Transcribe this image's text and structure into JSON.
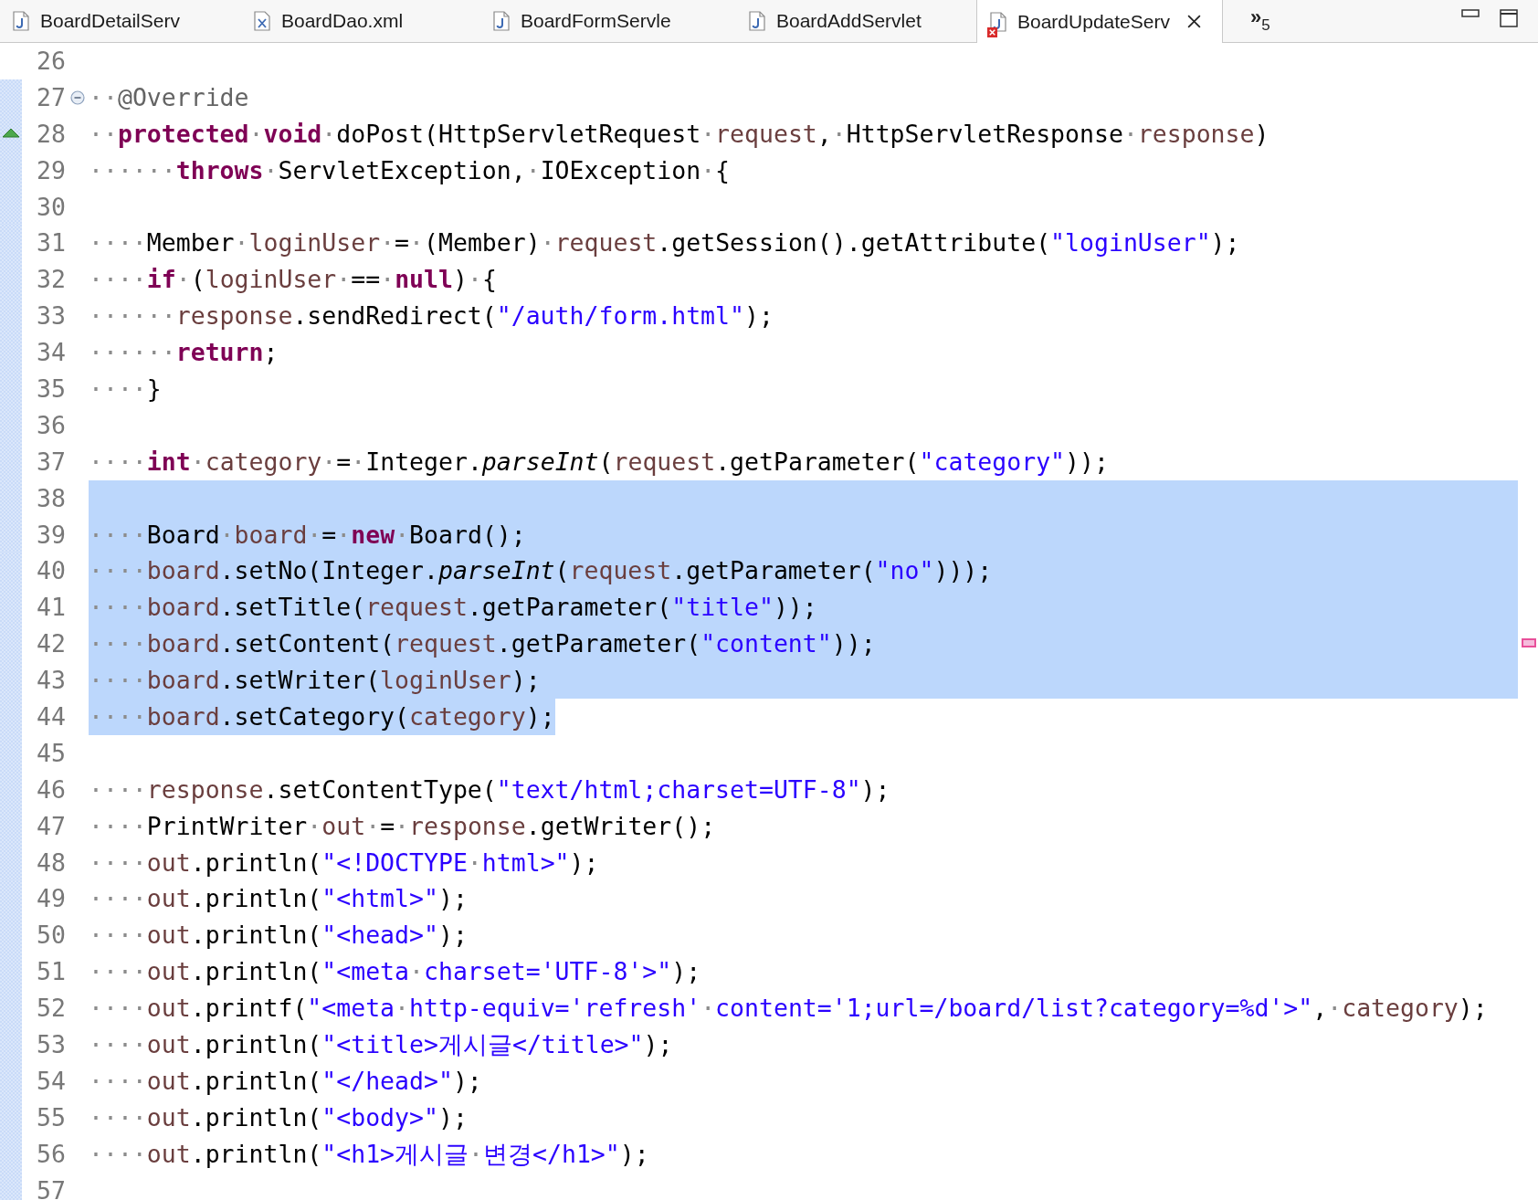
{
  "tabs": [
    {
      "label": "BoardDetailServ",
      "kind": "java",
      "selected": false,
      "error": false
    },
    {
      "label": "BoardDao.xml",
      "kind": "xml",
      "selected": false,
      "error": false
    },
    {
      "label": "BoardFormServle",
      "kind": "java",
      "selected": false,
      "error": false
    },
    {
      "label": "BoardAddServlet",
      "kind": "java",
      "selected": false,
      "error": false
    },
    {
      "label": "BoardUpdateServ",
      "kind": "java",
      "selected": true,
      "error": true
    }
  ],
  "overflow": {
    "chevron": "»",
    "count": "5"
  },
  "lines": [
    {
      "number": "26",
      "changed": false,
      "selected": false
    },
    {
      "number": "27",
      "changed": true,
      "selected": false,
      "foldable": true,
      "tokens": [
        {
          "kind": "ws",
          "text": "··"
        },
        {
          "kind": "ann",
          "text": "@Override"
        }
      ]
    },
    {
      "number": "28",
      "changed": true,
      "selected": false,
      "override": true,
      "tokens": [
        {
          "kind": "ws",
          "text": "··"
        },
        {
          "kind": "kw",
          "text": "protected"
        },
        {
          "kind": "ws",
          "text": "·"
        },
        {
          "kind": "kw",
          "text": "void"
        },
        {
          "kind": "ws",
          "text": "·"
        },
        {
          "kind": "p",
          "text": "doPost(HttpServletRequest"
        },
        {
          "kind": "ws",
          "text": "·"
        },
        {
          "kind": "var",
          "text": "request"
        },
        {
          "kind": "p",
          "text": ","
        },
        {
          "kind": "ws",
          "text": "·"
        },
        {
          "kind": "p",
          "text": "HttpServletResponse"
        },
        {
          "kind": "ws",
          "text": "·"
        },
        {
          "kind": "var",
          "text": "response"
        },
        {
          "kind": "p",
          "text": ")"
        }
      ]
    },
    {
      "number": "29",
      "changed": true,
      "selected": false,
      "tokens": [
        {
          "kind": "ws",
          "text": "······"
        },
        {
          "kind": "kw",
          "text": "throws"
        },
        {
          "kind": "ws",
          "text": "·"
        },
        {
          "kind": "p",
          "text": "ServletException,"
        },
        {
          "kind": "ws",
          "text": "·"
        },
        {
          "kind": "p",
          "text": "IOException"
        },
        {
          "kind": "ws",
          "text": "·"
        },
        {
          "kind": "p",
          "text": "{"
        }
      ]
    },
    {
      "number": "30",
      "changed": true,
      "selected": false
    },
    {
      "number": "31",
      "changed": true,
      "selected": false,
      "tokens": [
        {
          "kind": "ws",
          "text": "····"
        },
        {
          "kind": "p",
          "text": "Member"
        },
        {
          "kind": "ws",
          "text": "·"
        },
        {
          "kind": "var",
          "text": "loginUser"
        },
        {
          "kind": "ws",
          "text": "·"
        },
        {
          "kind": "p",
          "text": "="
        },
        {
          "kind": "ws",
          "text": "·"
        },
        {
          "kind": "p",
          "text": "(Member)"
        },
        {
          "kind": "ws",
          "text": "·"
        },
        {
          "kind": "var",
          "text": "request"
        },
        {
          "kind": "p",
          "text": ".getSession().getAttribute("
        },
        {
          "kind": "str",
          "text": "\"loginUser\""
        },
        {
          "kind": "p",
          "text": ");"
        }
      ]
    },
    {
      "number": "32",
      "changed": true,
      "selected": false,
      "tokens": [
        {
          "kind": "ws",
          "text": "····"
        },
        {
          "kind": "kw",
          "text": "if"
        },
        {
          "kind": "ws",
          "text": "·"
        },
        {
          "kind": "p",
          "text": "("
        },
        {
          "kind": "var",
          "text": "loginUser"
        },
        {
          "kind": "ws",
          "text": "·"
        },
        {
          "kind": "p",
          "text": "=="
        },
        {
          "kind": "ws",
          "text": "·"
        },
        {
          "kind": "kw",
          "text": "null"
        },
        {
          "kind": "p",
          "text": ")"
        },
        {
          "kind": "ws",
          "text": "·"
        },
        {
          "kind": "p",
          "text": "{"
        }
      ]
    },
    {
      "number": "33",
      "changed": true,
      "selected": false,
      "tokens": [
        {
          "kind": "ws",
          "text": "······"
        },
        {
          "kind": "var",
          "text": "response"
        },
        {
          "kind": "p",
          "text": ".sendRedirect("
        },
        {
          "kind": "str",
          "text": "\"/auth/form.html\""
        },
        {
          "kind": "p",
          "text": ");"
        }
      ]
    },
    {
      "number": "34",
      "changed": true,
      "selected": false,
      "tokens": [
        {
          "kind": "ws",
          "text": "······"
        },
        {
          "kind": "kw",
          "text": "return"
        },
        {
          "kind": "p",
          "text": ";"
        }
      ]
    },
    {
      "number": "35",
      "changed": true,
      "selected": false,
      "tokens": [
        {
          "kind": "ws",
          "text": "····"
        },
        {
          "kind": "p",
          "text": "}"
        }
      ]
    },
    {
      "number": "36",
      "changed": true,
      "selected": false
    },
    {
      "number": "37",
      "changed": true,
      "selected": false,
      "tokens": [
        {
          "kind": "ws",
          "text": "····"
        },
        {
          "kind": "kw",
          "text": "int"
        },
        {
          "kind": "ws",
          "text": "·"
        },
        {
          "kind": "var",
          "text": "category"
        },
        {
          "kind": "ws",
          "text": "·"
        },
        {
          "kind": "p",
          "text": "="
        },
        {
          "kind": "ws",
          "text": "·"
        },
        {
          "kind": "p",
          "text": "Integer."
        },
        {
          "kind": "it",
          "text": "parseInt"
        },
        {
          "kind": "p",
          "text": "("
        },
        {
          "kind": "var",
          "text": "request"
        },
        {
          "kind": "p",
          "text": ".getParameter("
        },
        {
          "kind": "str",
          "text": "\"category\""
        },
        {
          "kind": "p",
          "text": "));"
        }
      ]
    },
    {
      "number": "38",
      "changed": true,
      "selected": true
    },
    {
      "number": "39",
      "changed": true,
      "selected": true,
      "tokens": [
        {
          "kind": "ws",
          "text": "····"
        },
        {
          "kind": "p",
          "text": "Board"
        },
        {
          "kind": "ws",
          "text": "·"
        },
        {
          "kind": "var",
          "text": "board"
        },
        {
          "kind": "ws",
          "text": "·"
        },
        {
          "kind": "p",
          "text": "="
        },
        {
          "kind": "ws",
          "text": "·"
        },
        {
          "kind": "kw",
          "text": "new"
        },
        {
          "kind": "ws",
          "text": "·"
        },
        {
          "kind": "p",
          "text": "Board();"
        }
      ]
    },
    {
      "number": "40",
      "changed": true,
      "selected": true,
      "tokens": [
        {
          "kind": "ws",
          "text": "····"
        },
        {
          "kind": "var",
          "text": "board"
        },
        {
          "kind": "p",
          "text": ".setNo(Integer."
        },
        {
          "kind": "it",
          "text": "parseInt"
        },
        {
          "kind": "p",
          "text": "("
        },
        {
          "kind": "var",
          "text": "request"
        },
        {
          "kind": "p",
          "text": ".getParameter("
        },
        {
          "kind": "str",
          "text": "\"no\""
        },
        {
          "kind": "p",
          "text": ")));"
        }
      ]
    },
    {
      "number": "41",
      "changed": true,
      "selected": true,
      "tokens": [
        {
          "kind": "ws",
          "text": "····"
        },
        {
          "kind": "var",
          "text": "board"
        },
        {
          "kind": "p",
          "text": ".setTitle("
        },
        {
          "kind": "var",
          "text": "request"
        },
        {
          "kind": "p",
          "text": ".getParameter("
        },
        {
          "kind": "str",
          "text": "\"title\""
        },
        {
          "kind": "p",
          "text": "));"
        }
      ]
    },
    {
      "number": "42",
      "changed": true,
      "selected": true,
      "ruler_mark": true,
      "tokens": [
        {
          "kind": "ws",
          "text": "····"
        },
        {
          "kind": "var",
          "text": "board"
        },
        {
          "kind": "p",
          "text": ".setContent("
        },
        {
          "kind": "var",
          "text": "request"
        },
        {
          "kind": "p",
          "text": ".getParameter("
        },
        {
          "kind": "str",
          "text": "\"content\""
        },
        {
          "kind": "p",
          "text": "));"
        }
      ]
    },
    {
      "number": "43",
      "changed": true,
      "selected": true,
      "tokens": [
        {
          "kind": "ws",
          "text": "····"
        },
        {
          "kind": "var",
          "text": "board"
        },
        {
          "kind": "p",
          "text": ".setWriter("
        },
        {
          "kind": "var",
          "text": "loginUser"
        },
        {
          "kind": "p",
          "text": ");"
        }
      ]
    },
    {
      "number": "44",
      "changed": true,
      "selected": true,
      "partial": true,
      "tokens": [
        {
          "kind": "ws",
          "text": "····"
        },
        {
          "kind": "var",
          "text": "board"
        },
        {
          "kind": "p",
          "text": ".setCategory("
        },
        {
          "kind": "var",
          "text": "category"
        },
        {
          "kind": "p",
          "text": ");"
        }
      ]
    },
    {
      "number": "45",
      "changed": true,
      "selected": false
    },
    {
      "number": "46",
      "changed": true,
      "selected": false,
      "tokens": [
        {
          "kind": "ws",
          "text": "····"
        },
        {
          "kind": "var",
          "text": "response"
        },
        {
          "kind": "p",
          "text": ".setContentType("
        },
        {
          "kind": "str",
          "text": "\"text/html;charset=UTF-8\""
        },
        {
          "kind": "p",
          "text": ");"
        }
      ]
    },
    {
      "number": "47",
      "changed": true,
      "selected": false,
      "tokens": [
        {
          "kind": "ws",
          "text": "····"
        },
        {
          "kind": "p",
          "text": "PrintWriter"
        },
        {
          "kind": "ws",
          "text": "·"
        },
        {
          "kind": "var",
          "text": "out"
        },
        {
          "kind": "ws",
          "text": "·"
        },
        {
          "kind": "p",
          "text": "="
        },
        {
          "kind": "ws",
          "text": "·"
        },
        {
          "kind": "var",
          "text": "response"
        },
        {
          "kind": "p",
          "text": ".getWriter();"
        }
      ]
    },
    {
      "number": "48",
      "changed": true,
      "selected": false,
      "tokens": [
        {
          "kind": "ws",
          "text": "····"
        },
        {
          "kind": "var",
          "text": "out"
        },
        {
          "kind": "p",
          "text": ".println("
        },
        {
          "kind": "str",
          "text": "\"<!DOCTYPE"
        },
        {
          "kind": "ws",
          "text": "·"
        },
        {
          "kind": "str",
          "text": "html>\""
        },
        {
          "kind": "p",
          "text": ");"
        }
      ]
    },
    {
      "number": "49",
      "changed": true,
      "selected": false,
      "tokens": [
        {
          "kind": "ws",
          "text": "····"
        },
        {
          "kind": "var",
          "text": "out"
        },
        {
          "kind": "p",
          "text": ".println("
        },
        {
          "kind": "str",
          "text": "\"<html>\""
        },
        {
          "kind": "p",
          "text": ");"
        }
      ]
    },
    {
      "number": "50",
      "changed": true,
      "selected": false,
      "tokens": [
        {
          "kind": "ws",
          "text": "····"
        },
        {
          "kind": "var",
          "text": "out"
        },
        {
          "kind": "p",
          "text": ".println("
        },
        {
          "kind": "str",
          "text": "\"<head>\""
        },
        {
          "kind": "p",
          "text": ");"
        }
      ]
    },
    {
      "number": "51",
      "changed": true,
      "selected": false,
      "tokens": [
        {
          "kind": "ws",
          "text": "····"
        },
        {
          "kind": "var",
          "text": "out"
        },
        {
          "kind": "p",
          "text": ".println("
        },
        {
          "kind": "str",
          "text": "\"<meta"
        },
        {
          "kind": "ws",
          "text": "·"
        },
        {
          "kind": "str",
          "text": "charset='UTF-8'>\""
        },
        {
          "kind": "p",
          "text": ");"
        }
      ]
    },
    {
      "number": "52",
      "changed": true,
      "selected": false,
      "tokens": [
        {
          "kind": "ws",
          "text": "····"
        },
        {
          "kind": "var",
          "text": "out"
        },
        {
          "kind": "p",
          "text": ".printf("
        },
        {
          "kind": "str",
          "text": "\"<meta"
        },
        {
          "kind": "ws",
          "text": "·"
        },
        {
          "kind": "str",
          "text": "http-equiv='refresh'"
        },
        {
          "kind": "ws",
          "text": "·"
        },
        {
          "kind": "str",
          "text": "content='1;url=/board/list?category=%d'>\""
        },
        {
          "kind": "p",
          "text": ","
        },
        {
          "kind": "ws",
          "text": "·"
        },
        {
          "kind": "var",
          "text": "category"
        },
        {
          "kind": "p",
          "text": ");"
        }
      ]
    },
    {
      "number": "53",
      "changed": true,
      "selected": false,
      "tokens": [
        {
          "kind": "ws",
          "text": "····"
        },
        {
          "kind": "var",
          "text": "out"
        },
        {
          "kind": "p",
          "text": ".println("
        },
        {
          "kind": "str",
          "text": "\"<title>게시글</title>\""
        },
        {
          "kind": "p",
          "text": ");"
        }
      ]
    },
    {
      "number": "54",
      "changed": true,
      "selected": false,
      "tokens": [
        {
          "kind": "ws",
          "text": "····"
        },
        {
          "kind": "var",
          "text": "out"
        },
        {
          "kind": "p",
          "text": ".println("
        },
        {
          "kind": "str",
          "text": "\"</head>\""
        },
        {
          "kind": "p",
          "text": ");"
        }
      ]
    },
    {
      "number": "55",
      "changed": true,
      "selected": false,
      "tokens": [
        {
          "kind": "ws",
          "text": "····"
        },
        {
          "kind": "var",
          "text": "out"
        },
        {
          "kind": "p",
          "text": ".println("
        },
        {
          "kind": "str",
          "text": "\"<body>\""
        },
        {
          "kind": "p",
          "text": ");"
        }
      ]
    },
    {
      "number": "56",
      "changed": true,
      "selected": false,
      "tokens": [
        {
          "kind": "ws",
          "text": "····"
        },
        {
          "kind": "var",
          "text": "out"
        },
        {
          "kind": "p",
          "text": ".println("
        },
        {
          "kind": "str",
          "text": "\"<h1>게시글"
        },
        {
          "kind": "ws",
          "text": "·"
        },
        {
          "kind": "str",
          "text": "변경</h1>\""
        },
        {
          "kind": "p",
          "text": ");"
        }
      ]
    },
    {
      "number": "57",
      "changed": true,
      "selected": false
    }
  ]
}
